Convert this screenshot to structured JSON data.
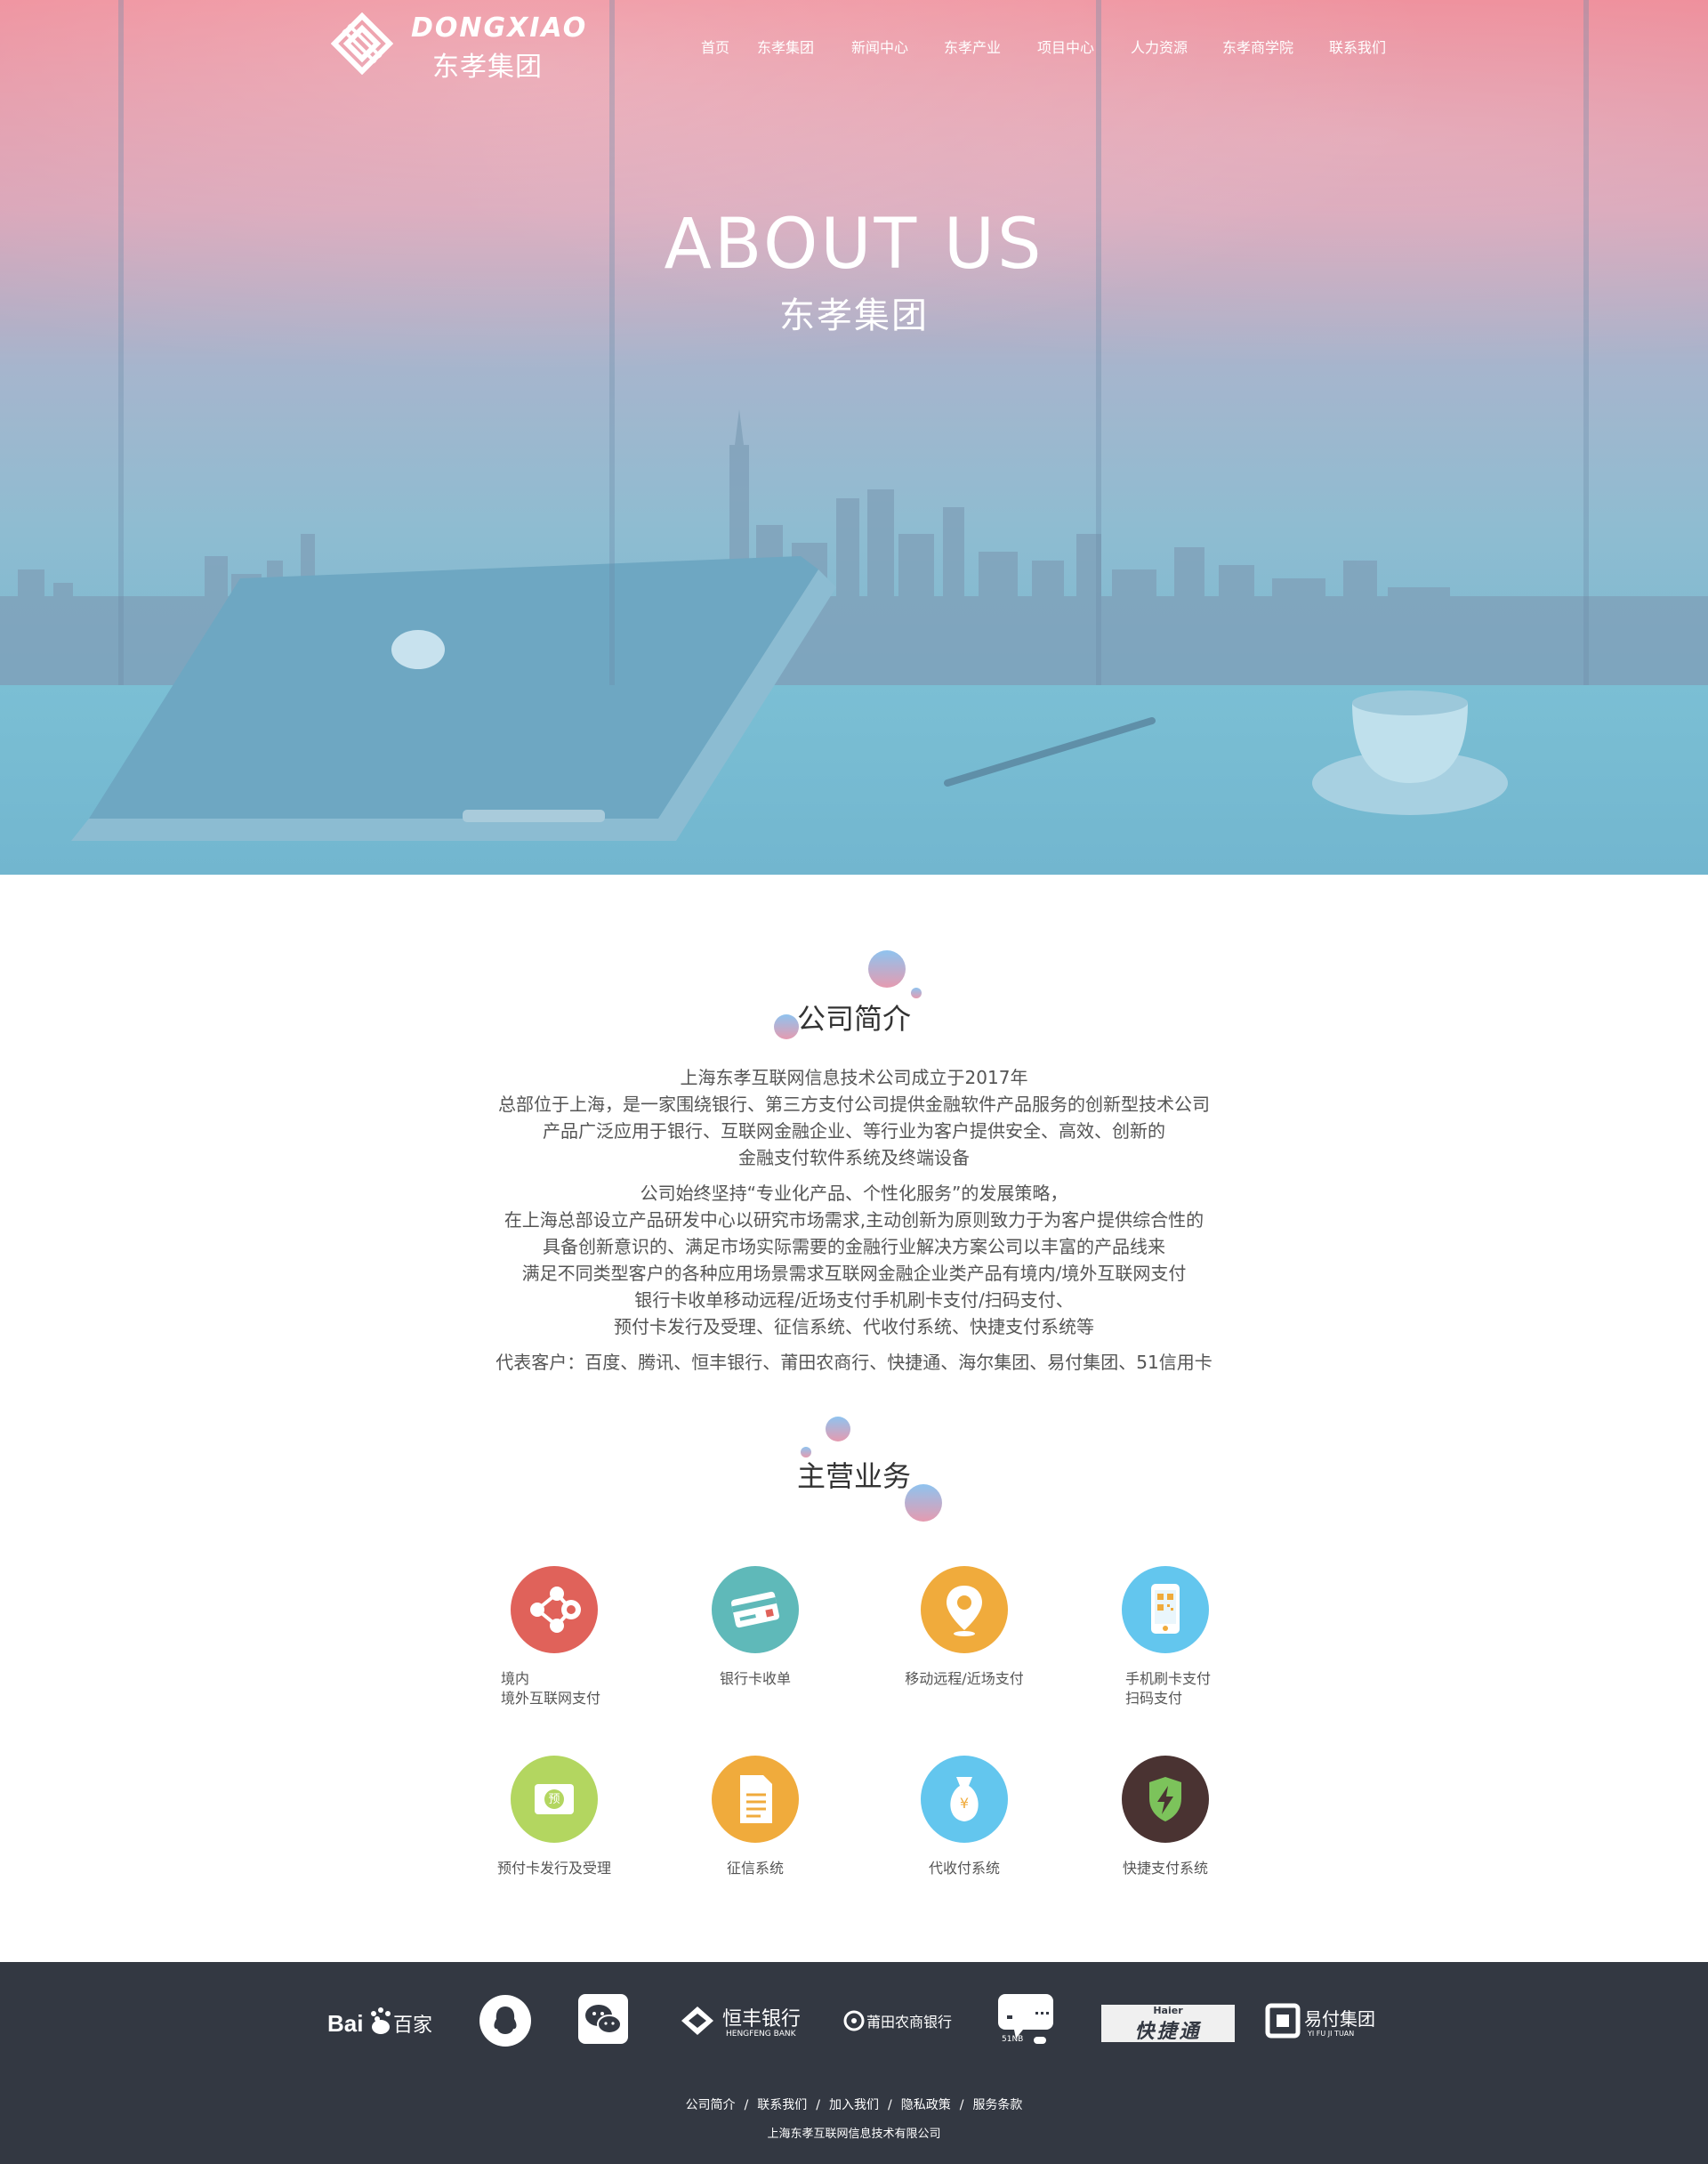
{
  "brand": {
    "name_en": "DONGXIAO",
    "name_cn": "东孝集团"
  },
  "nav": {
    "items": [
      "首页",
      "东孝集团",
      "新闻中心",
      "东孝产业",
      "项目中心",
      "人力资源",
      "东孝商学院",
      "联系我们"
    ]
  },
  "hero": {
    "title": "ABOUT US",
    "subtitle": "东孝集团"
  },
  "intro": {
    "title": "公司简介",
    "paragraph1": [
      "上海东孝互联网信息技术公司成立于2017年",
      "总部位于上海，是一家围绕银行、第三方支付公司提供金融软件产品服务的创新型技术公司",
      "产品广泛应用于银行、互联网金融企业、等行业为客户提供安全、高效、创新的",
      "金融支付软件系统及终端设备"
    ],
    "paragraph2": [
      "公司始终坚持“专业化产品、个性化服务”的发展策略，",
      "在上海总部设立产品研发中心以研究市场需求,主动创新为原则致力于为客户提供综合性的",
      "具备创新意识的、满足市场实际需要的金融行业解决方案公司以丰富的产品线来",
      "满足不同类型客户的各种应用场景需求互联网金融企业类产品有境内/境外互联网支付",
      "银行卡收单移动远程/近场支付手机刷卡支付/扫码支付、",
      "预付卡发行及受理、征信系统、代收付系统、快捷支付系统等"
    ],
    "clients": "代表客户：百度、腾讯、恒丰银行、莆田农商行、快捷通、海尔集团、易付集团、51信用卡"
  },
  "services": {
    "title": "主营业务",
    "items": [
      {
        "label_1": "境内",
        "label_2": "境外互联网支付",
        "icon": "share-network-icon",
        "color": "#e0625a"
      },
      {
        "label_1": "银行卡收单",
        "label_2": "",
        "icon": "credit-card-icon",
        "color": "#5fb9b9"
      },
      {
        "label_1": "移动远程/近场支付",
        "label_2": "",
        "icon": "location-pin-icon",
        "color": "#f0ab3c"
      },
      {
        "label_1": "手机刷卡支付",
        "label_2": "扫码支付",
        "icon": "mobile-qr-icon",
        "color": "#63c6ee"
      },
      {
        "label_1": "预付卡发行及受理",
        "label_2": "",
        "icon": "prepaid-card-icon",
        "color": "#b3d660",
        "glyph": "预"
      },
      {
        "label_1": "征信系统",
        "label_2": "",
        "icon": "document-icon",
        "color": "#f0ab3c"
      },
      {
        "label_1": "代收付系统",
        "label_2": "",
        "icon": "money-bag-icon",
        "color": "#63c6ee",
        "glyph": "¥"
      },
      {
        "label_1": "快捷支付系统",
        "label_2": "",
        "icon": "shield-bolt-icon",
        "color": "#4a3332"
      }
    ]
  },
  "partners": [
    {
      "name": "Bai百家",
      "icon": "baidu-logo"
    },
    {
      "name": "QQ",
      "icon": "qq-logo"
    },
    {
      "name": "WeChat",
      "icon": "wechat-logo"
    },
    {
      "name": "恒丰银行",
      "sub": "HENGFENG BANK",
      "icon": "hengfeng-bank-logo"
    },
    {
      "name": "莆田农商银行",
      "icon": "putian-bank-logo"
    },
    {
      "name": "51信用卡",
      "sub": "51NB",
      "icon": "51nb-logo"
    },
    {
      "name": "快捷通",
      "sub": "Haier",
      "icon": "kuaijietong-logo"
    },
    {
      "name": "易付集团",
      "sub": "YI FU JI TUAN",
      "icon": "yifu-logo"
    }
  ],
  "footer": {
    "links": [
      "公司简介",
      "联系我们",
      "加入我们",
      "隐私政策",
      "服务条款"
    ],
    "separator": "/",
    "copyright": "上海东孝互联网信息技术有限公司"
  },
  "colors": {
    "hero_top": "#ee8a97",
    "hero_bottom": "#73b6cf",
    "footer_bg": "#333842",
    "bubble_blue": "#8fc3ef",
    "bubble_pink": "#e59bb0"
  }
}
